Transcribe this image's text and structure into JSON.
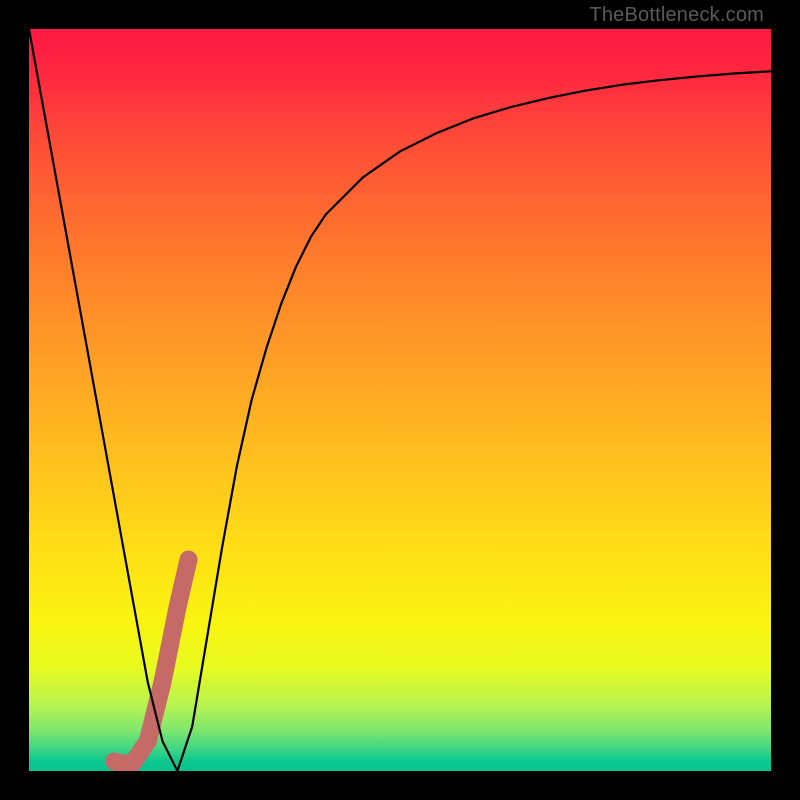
{
  "watermark": "TheBottleneck.com",
  "colors": {
    "curve": "#000000",
    "highlight": "#c56a66",
    "frame": "#000000"
  },
  "chart_data": {
    "type": "line",
    "title": "",
    "xlabel": "",
    "ylabel": "",
    "xlim": [
      0,
      100
    ],
    "ylim": [
      0,
      100
    ],
    "grid": false,
    "legend": false,
    "series": [
      {
        "name": "bottleneck-curve",
        "x": [
          0,
          2,
          4,
          6,
          8,
          10,
          12,
          14,
          16,
          18,
          20,
          22,
          24,
          26,
          28,
          30,
          32,
          34,
          36,
          38,
          40,
          45,
          50,
          55,
          60,
          65,
          70,
          75,
          80,
          85,
          90,
          95,
          100
        ],
        "y": [
          100,
          89,
          78,
          67,
          56,
          45,
          34,
          23,
          12,
          4,
          0,
          6,
          18,
          30,
          41,
          50,
          57,
          63,
          68,
          72,
          75,
          80,
          83.5,
          86,
          88,
          89.5,
          90.7,
          91.7,
          92.5,
          93.1,
          93.6,
          94.0,
          94.3
        ]
      },
      {
        "name": "highlight-segment",
        "x": [
          11.5,
          12.5,
          14,
          16,
          18,
          20,
          21.5
        ],
        "y": [
          1.3,
          1.0,
          1.1,
          4.0,
          12.0,
          22.0,
          28.5
        ]
      }
    ]
  }
}
